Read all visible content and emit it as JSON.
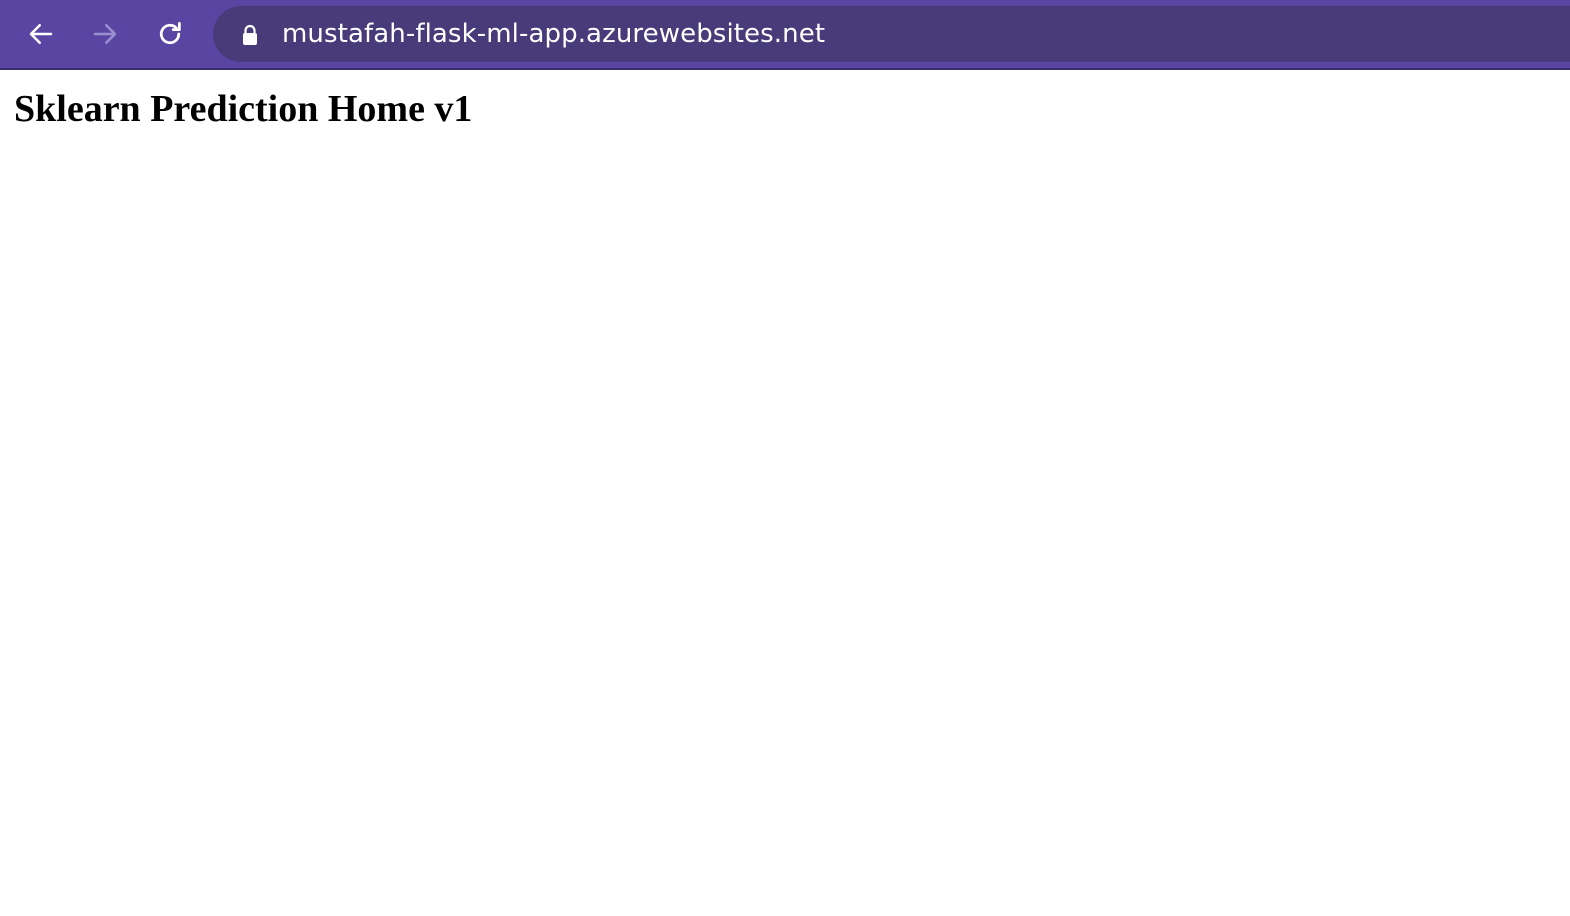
{
  "browser": {
    "url": "mustafah-flask-ml-app.azurewebsites.net",
    "icons": {
      "back": "back-arrow-icon",
      "forward": "forward-arrow-icon",
      "reload": "reload-icon",
      "lock": "lock-icon"
    },
    "forward_enabled": false,
    "colors": {
      "toolbar": "#5a45a3",
      "omnibox": "#483b7a",
      "icon": "#ffffff",
      "icon_disabled": "#9a8fce"
    }
  },
  "page": {
    "heading": "Sklearn Prediction Home v1"
  }
}
